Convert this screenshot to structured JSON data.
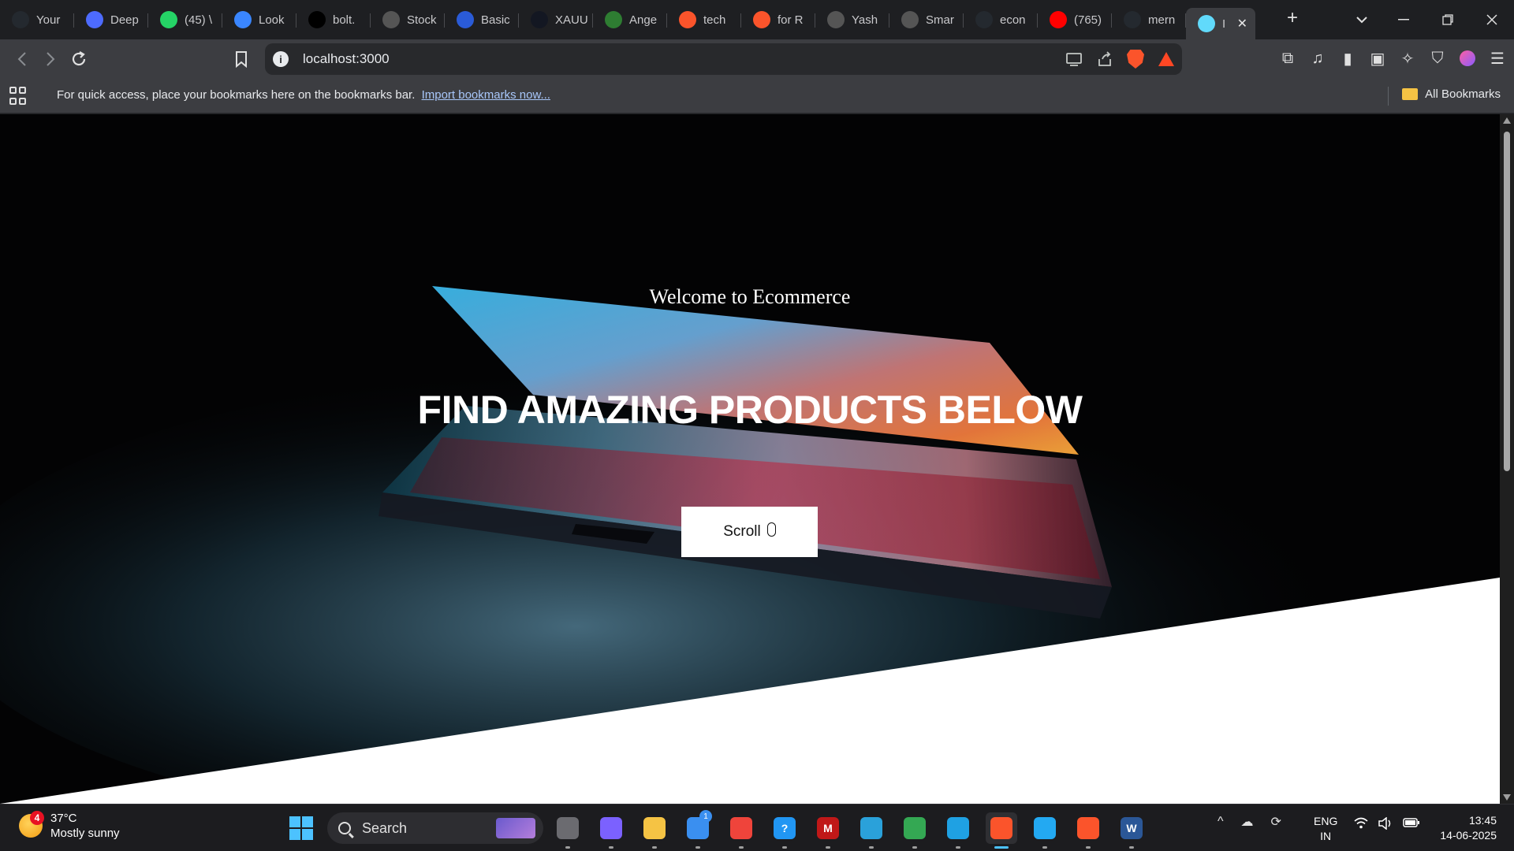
{
  "browser": {
    "tabs": [
      {
        "title": "Your",
        "icon": "github-icon",
        "color": "#24292f"
      },
      {
        "title": "Deep",
        "icon": "deepseek-icon",
        "color": "#4d6bfe"
      },
      {
        "title": "(45) \\",
        "icon": "whatsapp-icon",
        "color": "#25d366"
      },
      {
        "title": "Look",
        "icon": "doc-icon",
        "color": "#3a86ff"
      },
      {
        "title": "bolt.",
        "icon": "bolt-icon",
        "color": "#000000"
      },
      {
        "title": "Stock",
        "icon": "openai-icon",
        "color": "#555555"
      },
      {
        "title": "Basic",
        "icon": "c-icon",
        "color": "#2a5bd7"
      },
      {
        "title": "XAUU",
        "icon": "tradingview-icon",
        "color": "#131722"
      },
      {
        "title": "Ange",
        "icon": "angel-icon",
        "color": "#2e7d32"
      },
      {
        "title": "tech",
        "icon": "brave-icon",
        "color": "#fb542b"
      },
      {
        "title": "for R",
        "icon": "brave-icon",
        "color": "#fb542b"
      },
      {
        "title": "Yash",
        "icon": "openai-icon",
        "color": "#555555"
      },
      {
        "title": "Smar",
        "icon": "openai-icon",
        "color": "#555555"
      },
      {
        "title": "econ",
        "icon": "github-icon",
        "color": "#24292f"
      },
      {
        "title": "(765)",
        "icon": "youtube-icon",
        "color": "#ff0000"
      },
      {
        "title": "mern",
        "icon": "github-icon",
        "color": "#24292f"
      },
      {
        "title": "I",
        "icon": "react-icon",
        "color": "#61dafb",
        "active": true
      }
    ],
    "new_tab_label": "+",
    "tab_search_label": "⌄",
    "window_controls": {
      "minimize": "—",
      "restore": "❐",
      "close": "✕"
    },
    "url": "localhost:3000",
    "bookmarks_bar": {
      "message": "For quick access, place your bookmarks here on the bookmarks bar.",
      "import_link": "Import bookmarks now...",
      "all_bookmarks": "All Bookmarks"
    }
  },
  "page": {
    "welcome": "Welcome to Ecommerce",
    "headline": "FIND AMAZING PRODUCTS BELOW",
    "scroll_button": "Scroll",
    "colors": {
      "hero_bg": "#030304",
      "wedge": "#ffffff",
      "button_bg": "#ffffff"
    }
  },
  "taskbar": {
    "weather": {
      "badge": "4",
      "temp": "37°C",
      "condition": "Mostly sunny"
    },
    "search_placeholder": "Search",
    "apps": [
      {
        "name": "task-view",
        "color": "#6b6b70",
        "label": ""
      },
      {
        "name": "copilot",
        "color": "#7b61ff",
        "label": ""
      },
      {
        "name": "file-explorer",
        "color": "#f5c344",
        "label": ""
      },
      {
        "name": "microsoft-store",
        "color": "#3a8ff0",
        "label": "",
        "badge": "1"
      },
      {
        "name": "anydesk",
        "color": "#ef443b",
        "label": ""
      },
      {
        "name": "help",
        "color": "#2196f3",
        "label": "?"
      },
      {
        "name": "mcafee",
        "color": "#c01818",
        "label": "M"
      },
      {
        "name": "telegram",
        "color": "#2aa1da",
        "label": ""
      },
      {
        "name": "chrome",
        "color": "#34a853",
        "label": ""
      },
      {
        "name": "edge",
        "color": "#1fa1e3",
        "label": ""
      },
      {
        "name": "brave",
        "color": "#fb542b",
        "label": "",
        "active": true
      },
      {
        "name": "vscode",
        "color": "#23a9f2",
        "label": ""
      },
      {
        "name": "brave-beta",
        "color": "#fb542b",
        "label": ""
      },
      {
        "name": "word",
        "color": "#2b5797",
        "label": "W"
      }
    ],
    "tray": {
      "chevron": "^",
      "lang_1": "ENG",
      "lang_2": "IN"
    },
    "clock": {
      "time": "13:45",
      "date": "14-06-2025"
    }
  }
}
